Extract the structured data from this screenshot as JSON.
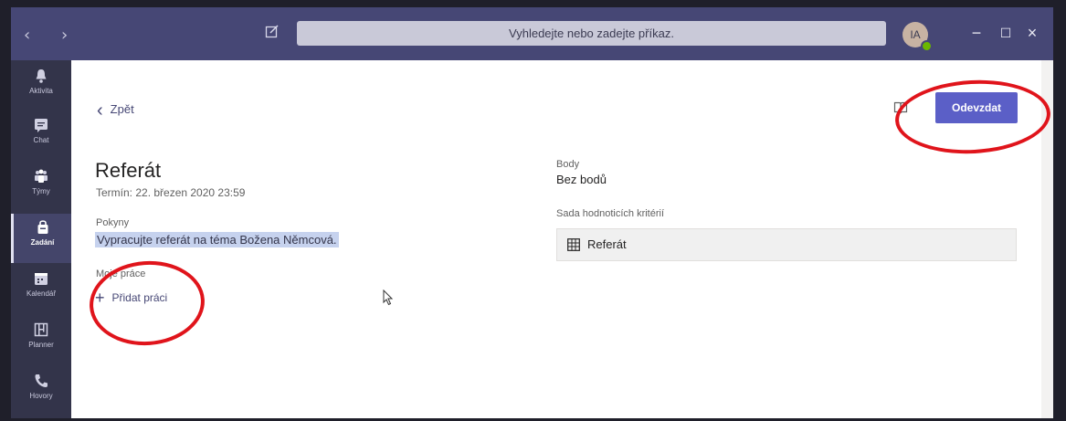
{
  "titlebar": {
    "back_arrow": "‹",
    "forward_arrow": "›",
    "compose_icon": "compose-icon",
    "search_placeholder": "Vyhledejte nebo zadejte příkaz.",
    "avatar_initials": "IA",
    "minimize": "−",
    "maximize": "☐",
    "close": "×"
  },
  "rail": {
    "items": [
      {
        "label": "Aktivita",
        "icon": "bell-icon"
      },
      {
        "label": "Chat",
        "icon": "chat-icon"
      },
      {
        "label": "Týmy",
        "icon": "teams-icon"
      },
      {
        "label": "Zadání",
        "icon": "assignments-icon",
        "active": true
      },
      {
        "label": "Kalendář",
        "icon": "calendar-icon"
      },
      {
        "label": "Planner",
        "icon": "planner-icon"
      },
      {
        "label": "Hovory",
        "icon": "phone-icon"
      }
    ]
  },
  "assignment": {
    "back_label": "Zpět",
    "title": "Referát",
    "due": "Termín: 22. březen 2020 23:59",
    "instructions_label": "Pokyny",
    "instructions": "Vypracujte referát na téma Božena Němcová.",
    "my_work_label": "Moje práce",
    "add_work_label": "Přidat práci",
    "points_label": "Body",
    "points_value": "Bez bodů",
    "rubric_label": "Sada hodnoticích kritérií",
    "rubric_value": "Referát",
    "submit_label": "Odevzdat"
  },
  "colors": {
    "titlebar": "#464775",
    "rail": "#33344a",
    "accent": "#5b5fc7",
    "annotation": "#e0141b"
  }
}
